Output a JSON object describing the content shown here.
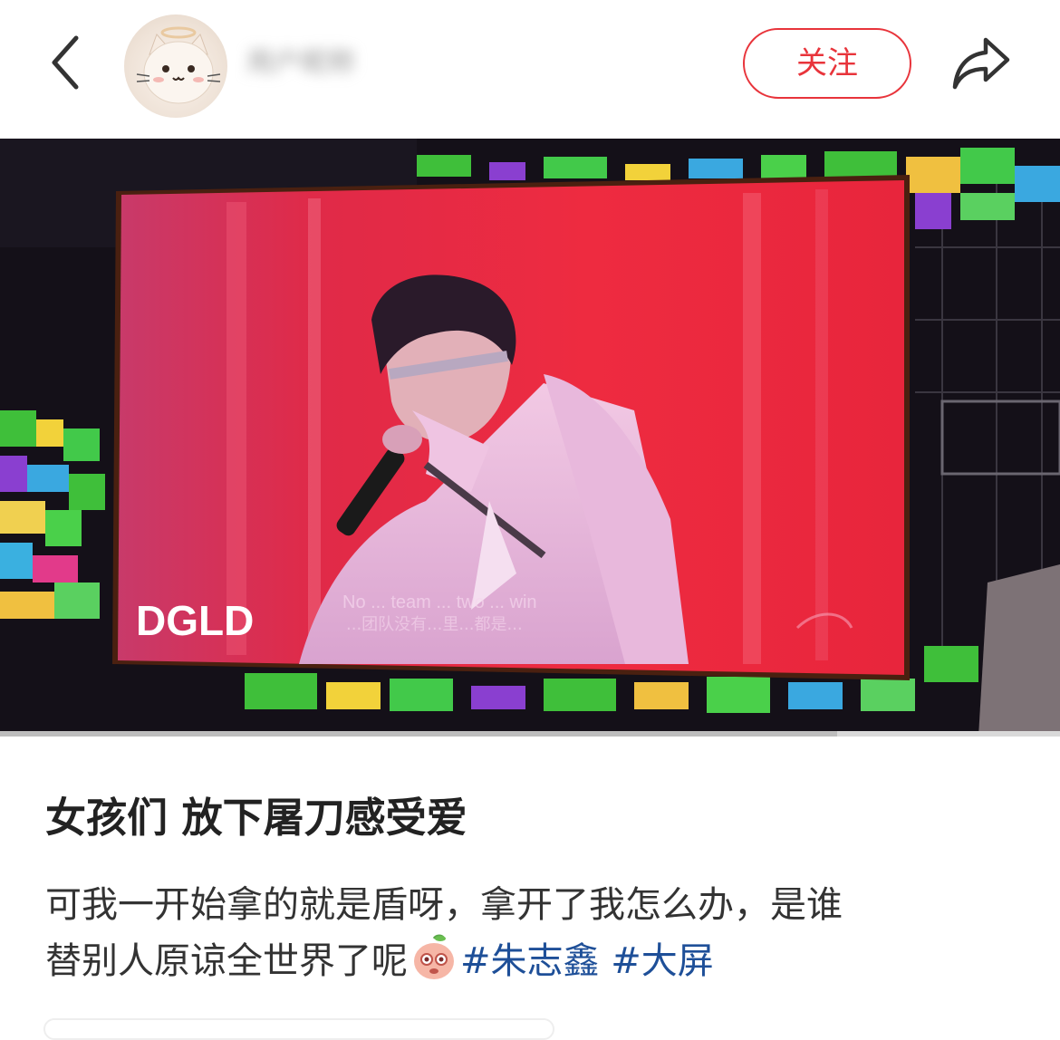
{
  "header": {
    "back_icon": "chevron-left-icon",
    "avatar_icon": "cat-with-halo-avatar",
    "username": "用户昵称",
    "follow_label": "关注",
    "share_icon": "share-arrow-icon"
  },
  "photo": {
    "screen_caption": "DGLD",
    "subtitle_en": "No ... team ... two ... win",
    "subtitle_cn": "...团队没有...里...都是...",
    "progress_fraction": 0.79
  },
  "post": {
    "title": "女孩们 放下屠刀感受爱",
    "body_line1": "可我一开始拿的就是盾呀，拿开了我怎么办，是谁",
    "body_line2": "替别人原谅全世界了呢",
    "emoji_icon": "peach-face-emoji",
    "tags": [
      "#朱志鑫",
      "#大屏"
    ]
  },
  "colors": {
    "accent_red": "#e8343b",
    "tag_blue": "#1e4f98"
  }
}
